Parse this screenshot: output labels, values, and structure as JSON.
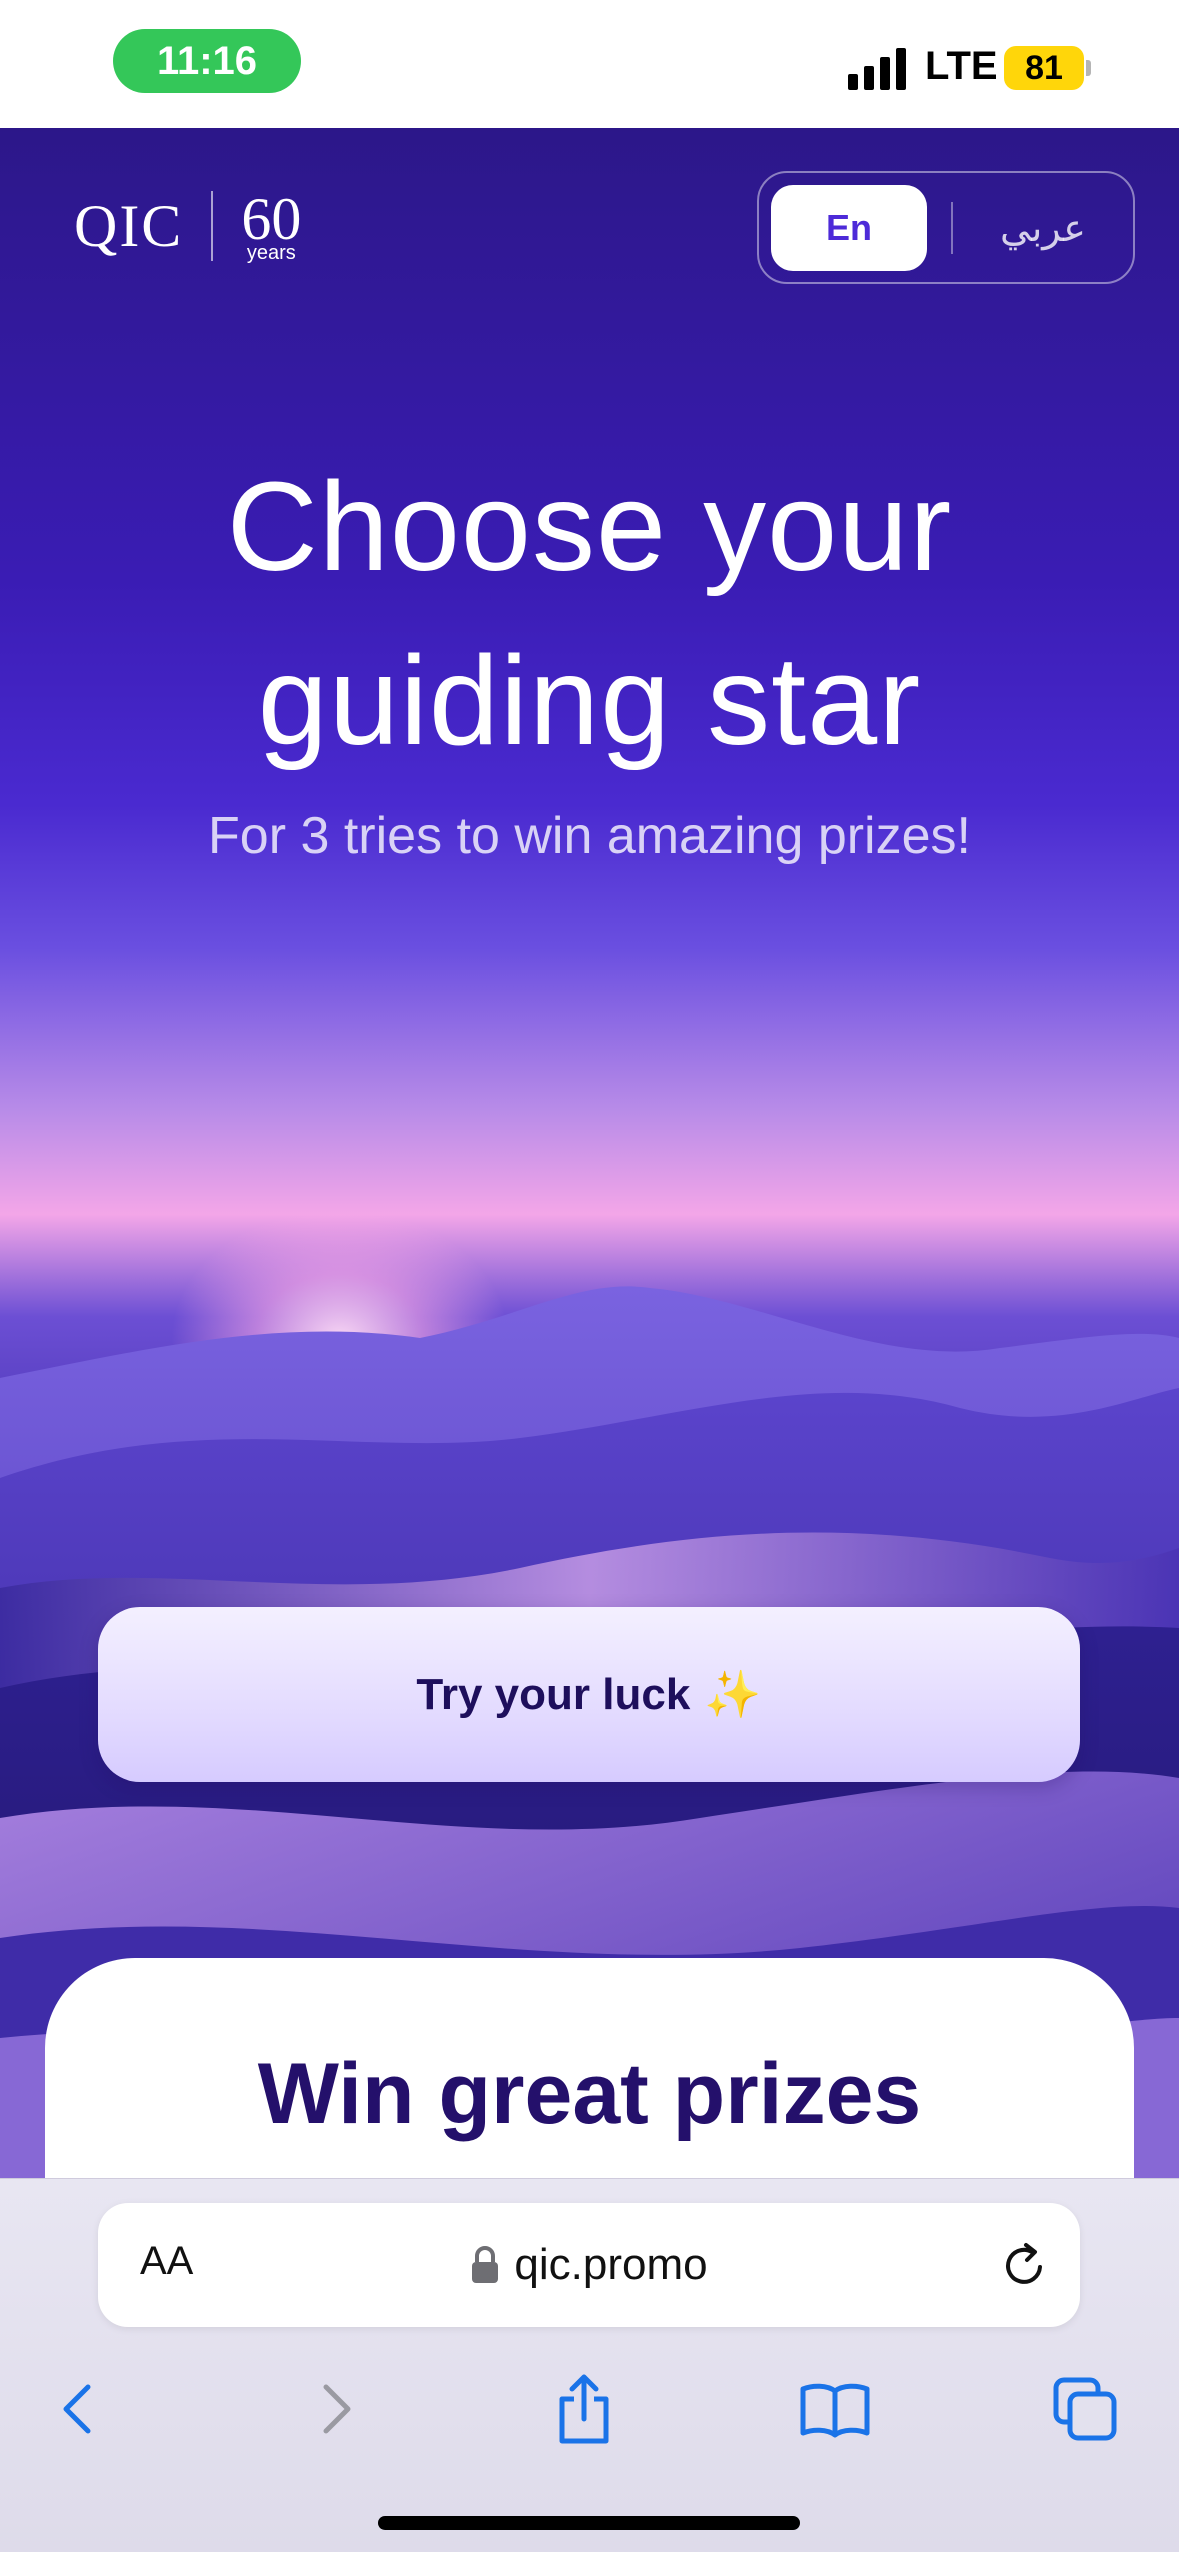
{
  "status_bar": {
    "time": "11:16",
    "carrier": "LTE",
    "battery": "81"
  },
  "header": {
    "logo_text": "QIC",
    "logo_years_number": "60",
    "logo_years_word": "years",
    "lang_en": "En",
    "lang_ar": "عربي"
  },
  "hero": {
    "title_line1": "Choose your",
    "title_line2": "guiding star",
    "subtitle": "For 3 tries to win amazing prizes!",
    "cta_label": "Try your luck",
    "cta_emoji": "✨"
  },
  "prizes": {
    "title": "Win great prizes"
  },
  "browser": {
    "text_size_label": "AA",
    "url": "qic.promo",
    "nav_icons": [
      "back-icon",
      "forward-icon",
      "share-icon",
      "bookmarks-icon",
      "tabs-icon"
    ]
  },
  "colors": {
    "accent": "#4d2ad8",
    "hero_top": "#2c1789",
    "title_dark": "#24106b",
    "time_pill": "#34c759",
    "battery": "#ffd60a",
    "safari_blue": "#1a73e8"
  }
}
